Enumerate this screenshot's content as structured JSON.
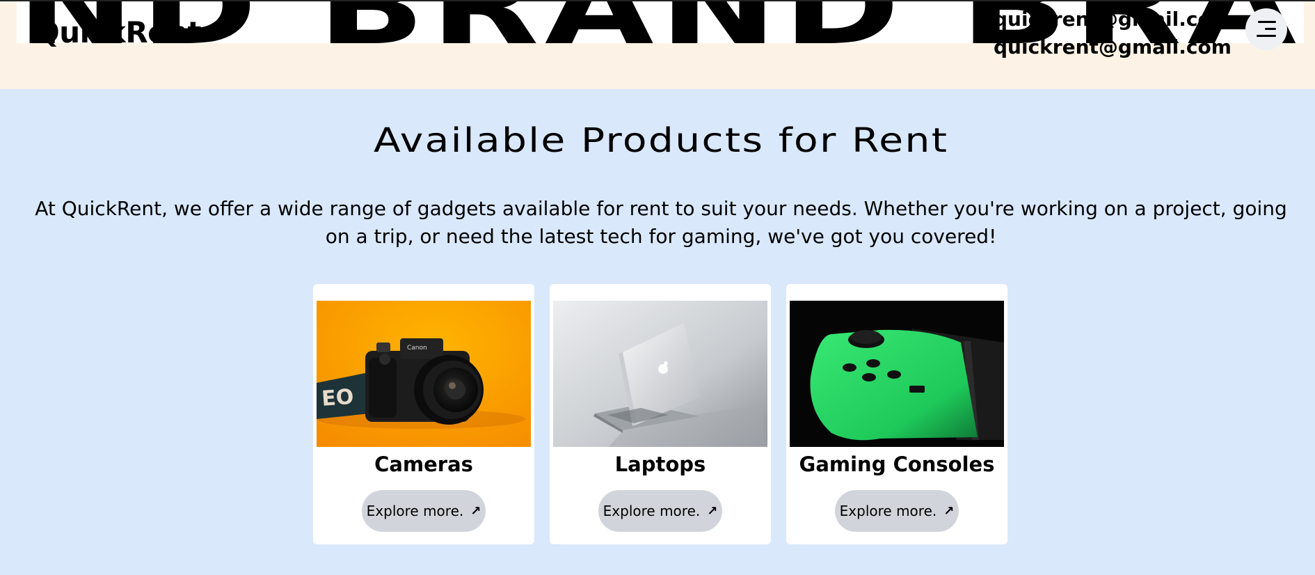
{
  "header": {
    "marquee_text": "ND BRAND BRAND",
    "logo": "QuickRent",
    "email_top": "quickrent@gmail.com",
    "email_bottom": "quickrent@gmail.com",
    "menu_icon": "hamburger-menu-icon"
  },
  "main": {
    "title": "Available Products for Rent",
    "intro": "At QuickRent, we offer a wide range of gadgets available for rent to suit your needs. Whether you're working on a project, going on a trip, or need the latest tech for gaming, we've got you covered!",
    "cards": [
      {
        "title": "Cameras",
        "button": "Explore more.",
        "icon": "arrow-up-right-icon",
        "image": "camera-photo"
      },
      {
        "title": "Laptops",
        "button": "Explore more.",
        "icon": "arrow-up-right-icon",
        "image": "laptop-photo"
      },
      {
        "title": "Gaming Consoles",
        "button": "Explore more.",
        "icon": "arrow-up-right-icon",
        "image": "game-controller-photo"
      }
    ]
  },
  "colors": {
    "header_bg": "#fcf3e6",
    "main_bg": "#d9e8fb",
    "button_bg": "#d1d5db",
    "camera_bg": "#ffa500",
    "controller_green": "#22d35e"
  }
}
